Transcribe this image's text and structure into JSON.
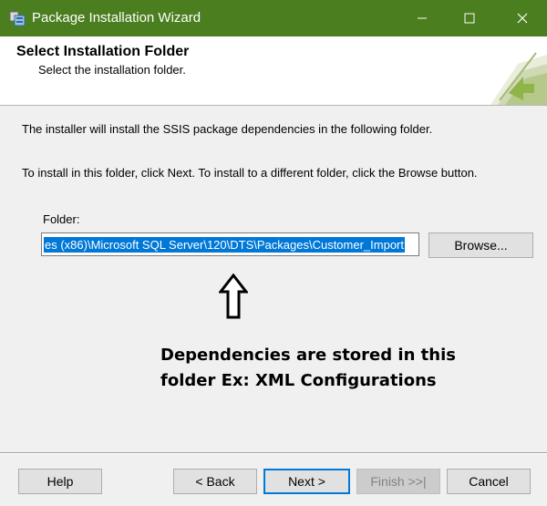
{
  "window": {
    "title": "Package Installation Wizard",
    "accent_color": "#4a7e1e",
    "controls": {
      "minimize_icon": "minimize-icon",
      "maximize_icon": "maximize-icon",
      "close_icon": "close-icon"
    }
  },
  "header": {
    "title": "Select Installation Folder",
    "subtitle": "Select the installation folder."
  },
  "body": {
    "intro_line_1": "The installer will install the SSIS package dependencies in the following folder.",
    "intro_line_2": "To install in this folder, click Next. To install to a different folder, click the Browse button.",
    "folder_label": "Folder:",
    "folder_value": "es (x86)\\Microsoft SQL Server\\120\\DTS\\Packages\\Customer_Import",
    "browse_label": "Browse..."
  },
  "annotation": {
    "line_1": "Dependencies are stored in this",
    "line_2": "folder Ex: XML Configurations"
  },
  "footer": {
    "help_label": "Help",
    "back_label": "< Back",
    "next_label": "Next >",
    "finish_label": "Finish >>|",
    "cancel_label": "Cancel"
  }
}
